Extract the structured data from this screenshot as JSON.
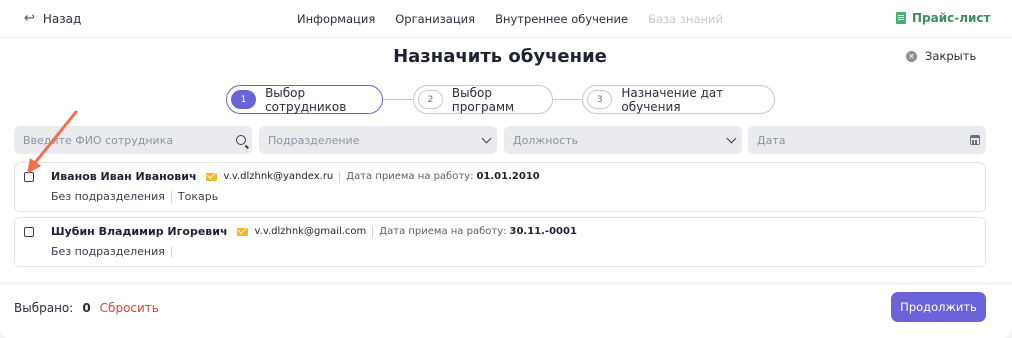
{
  "nav": {
    "back_label": "Назад",
    "items": [
      {
        "label": "Информация",
        "disabled": false
      },
      {
        "label": "Организация",
        "disabled": false
      },
      {
        "label": "Внутреннее обучение",
        "disabled": false
      },
      {
        "label": "База знаний",
        "disabled": true
      }
    ],
    "price_label": "Прайс-лист"
  },
  "title": "Назначить обучение",
  "close_label": "Закрыть",
  "steps": [
    {
      "num": "1",
      "label": "Выбор сотрудников",
      "active": true
    },
    {
      "num": "2",
      "label": "Выбор программ",
      "active": false
    },
    {
      "num": "3",
      "label": "Назначение дат обучения",
      "active": false
    }
  ],
  "filters": {
    "search_placeholder": "Введите ФИО сотрудника",
    "department_placeholder": "Подразделение",
    "position_placeholder": "Должность",
    "date_placeholder": "Дата"
  },
  "employees": [
    {
      "name": "Иванов Иван Иванович",
      "email": "v.v.dlzhnk@yandex.ru",
      "hire_label": "Дата приема на работу:",
      "hire_date": "01.01.2010",
      "department": "Без подразделения",
      "position": "Токарь",
      "checked": false
    },
    {
      "name": "Шубин Владимир Игоревич",
      "email": "v.v.dlzhnk@gmail.com",
      "hire_label": "Дата приема на работу:",
      "hire_date": "30.11.-0001",
      "department": "Без подразделения",
      "position": "",
      "checked": false
    }
  ],
  "footer": {
    "selected_label": "Выбрано:",
    "selected_count": "0",
    "reset_label": "Сбросить",
    "continue_label": "Продолжить"
  },
  "colors": {
    "accent": "#6c63d9",
    "price_green": "#3e8e5a",
    "reset_red": "#e0453a",
    "mail_yellow": "#f1b928",
    "annotation_arrow": "#f07050"
  }
}
